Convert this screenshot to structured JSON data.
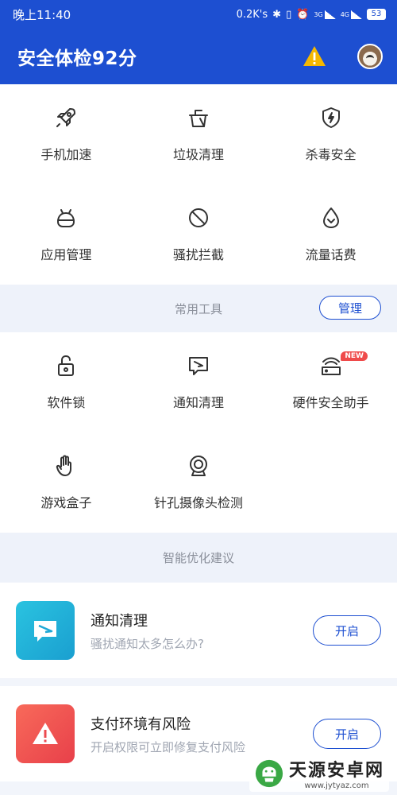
{
  "status_bar": {
    "time": "晚上11:40",
    "net_speed": "0.2K's",
    "net_3g": "3G",
    "net_4g": "4G",
    "battery": "53"
  },
  "header": {
    "title": "安全体检92分",
    "accent": "#1d4fd1"
  },
  "main_grid": [
    {
      "label": "手机加速",
      "icon": "rocket-icon"
    },
    {
      "label": "垃圾清理",
      "icon": "trash-icon"
    },
    {
      "label": "杀毒安全",
      "icon": "shield-bolt-icon"
    },
    {
      "label": "应用管理",
      "icon": "android-icon"
    },
    {
      "label": "骚扰拦截",
      "icon": "block-icon"
    },
    {
      "label": "流量话费",
      "icon": "drop-icon"
    }
  ],
  "tools_section": {
    "title": "常用工具",
    "manage_label": "管理"
  },
  "tools_grid": [
    {
      "label": "软件锁",
      "icon": "lock-icon"
    },
    {
      "label": "通知清理",
      "icon": "message-icon"
    },
    {
      "label": "硬件安全助手",
      "icon": "router-icon",
      "badge": "NEW"
    },
    {
      "label": "游戏盒子",
      "icon": "hand-icon"
    },
    {
      "label": "针孔摄像头检测",
      "icon": "webcam-icon"
    }
  ],
  "suggest_section": {
    "title": "智能优化建议"
  },
  "suggestions": [
    {
      "title": "通知清理",
      "desc": "骚扰通知太多怎么办?",
      "button": "开启",
      "icon": "message-icon",
      "color": "#20b2d8"
    },
    {
      "title": "支付环境有风险",
      "desc": "开启权限可立即修复支付风险",
      "button": "开启",
      "icon": "warning-icon",
      "color": "#f0504c"
    }
  ],
  "watermark": {
    "name": "天源安卓网",
    "url": "www.jytyaz.com"
  }
}
